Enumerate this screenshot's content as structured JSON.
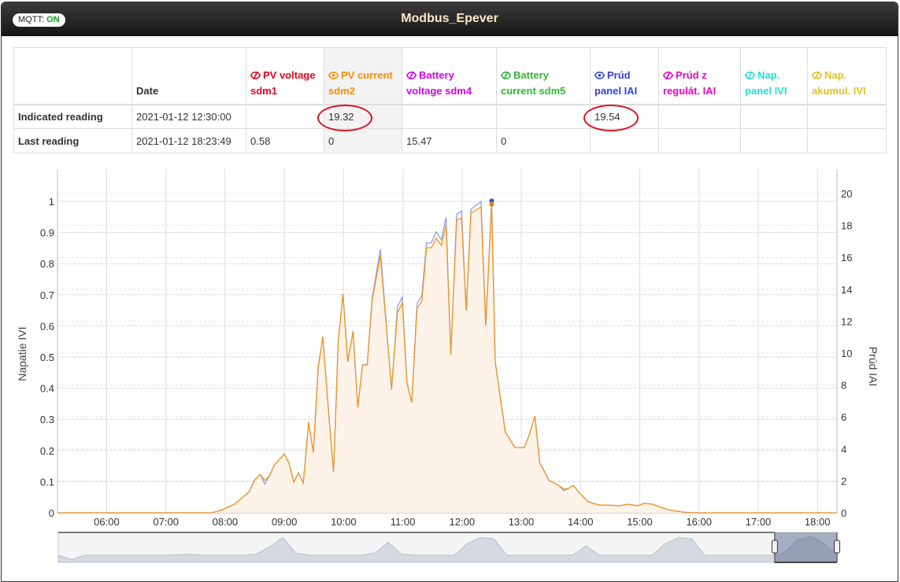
{
  "header": {
    "mqtt_label": "MQTT:",
    "mqtt_status": "ON",
    "title": "Modbus_Epever"
  },
  "table": {
    "date_header": "Date",
    "columns": [
      {
        "label": "PV voltage sdm1",
        "color": "#e8001c",
        "visible": false
      },
      {
        "label": "PV current sdm2",
        "color": "#ff8a00",
        "visible": true
      },
      {
        "label": "Battery voltage sdm4",
        "color": "#d600f0",
        "visible": false
      },
      {
        "label": "Battery current sdm5",
        "color": "#2fb82f",
        "visible": false
      },
      {
        "label": "Prúd panel IAI",
        "color": "#3340e0",
        "visible": true
      },
      {
        "label": "Prúd z regulát. IAI",
        "color": "#ee00c8",
        "visible": false
      },
      {
        "label": "Nap. panel IVI",
        "color": "#20e0d8",
        "visible": false
      },
      {
        "label": "Nap. akumul. IVI",
        "color": "#e6c020",
        "visible": false
      }
    ],
    "rows": [
      {
        "label": "Indicated reading",
        "date": "2021-01-12 12:30:00",
        "values": [
          "",
          "19.32",
          "",
          "",
          "19.54",
          "",
          "",
          ""
        ]
      },
      {
        "label": "Last reading",
        "date": "2021-01-12 18:23:49",
        "values": [
          "0.58",
          "0",
          "15.47",
          "0",
          "",
          "",
          "",
          ""
        ]
      }
    ]
  },
  "chart_data": {
    "type": "area",
    "left_axis": {
      "label": "Napatie IVI",
      "min": 0,
      "max": 1,
      "ticks": [
        "0",
        "0.1",
        "0.2",
        "0.3",
        "0.4",
        "0.5",
        "0.6",
        "0.7",
        "0.8",
        "0.9",
        "1"
      ]
    },
    "right_axis": {
      "label": "Prúd IAI",
      "min": 0,
      "max": 20,
      "ticks": [
        "0",
        "2",
        "4",
        "6",
        "8",
        "10",
        "12",
        "14",
        "16",
        "18",
        "20"
      ]
    },
    "x_axis": {
      "min": 5.17,
      "max": 18.33,
      "ticks": [
        "06:00",
        "07:00",
        "08:00",
        "09:00",
        "10:00",
        "11:00",
        "12:00",
        "13:00",
        "14:00",
        "15:00",
        "16:00",
        "17:00",
        "18:00"
      ]
    },
    "x_hours": [
      5.17,
      7.76,
      7.93,
      8.16,
      8.41,
      8.49,
      8.59,
      8.67,
      8.75,
      8.83,
      9.0,
      9.08,
      9.16,
      9.24,
      9.32,
      9.41,
      9.49,
      9.57,
      9.65,
      9.73,
      9.83,
      9.91,
      9.99,
      10.07,
      10.16,
      10.24,
      10.32,
      10.4,
      10.48,
      10.62,
      10.81,
      10.91,
      10.99,
      11.07,
      11.15,
      11.24,
      11.32,
      11.4,
      11.48,
      11.56,
      11.65,
      11.73,
      11.81,
      11.91,
      11.99,
      12.07,
      12.15,
      12.32,
      12.4,
      12.5,
      12.56,
      12.73,
      12.89,
      13.05,
      13.13,
      13.23,
      13.31,
      13.47,
      13.63,
      13.72,
      13.8,
      13.88,
      13.97,
      14.13,
      14.32,
      14.47,
      14.65,
      14.8,
      14.97,
      15.07,
      15.21,
      15.36,
      15.53,
      15.73,
      15.89,
      18.33
    ],
    "series": [
      {
        "name": "PV current sdm2",
        "axis": "right",
        "color": "#f7931e",
        "values": [
          0,
          0,
          0.15,
          0.54,
          1.33,
          2.02,
          2.41,
          2.02,
          2.32,
          2.99,
          3.69,
          3.1,
          1.92,
          2.51,
          1.87,
          5.67,
          3.79,
          9.06,
          11.03,
          7.14,
          2.56,
          10.79,
          13.7,
          9.46,
          11.38,
          6.6,
          9.26,
          9.26,
          13.25,
          16.1,
          7.83,
          12.53,
          13.15,
          8.18,
          6.9,
          12.82,
          13.25,
          16.6,
          16.6,
          17.19,
          16.75,
          18.03,
          9.9,
          18.33,
          18.47,
          12.66,
          18.77,
          19.16,
          11.72,
          19.32,
          9.46,
          5.07,
          4.09,
          4.09,
          4.83,
          6.06,
          3.15,
          2.02,
          1.72,
          1.48,
          1.53,
          1.72,
          1.28,
          0.69,
          0.49,
          0.49,
          0.44,
          0.54,
          0.44,
          0.59,
          0.54,
          0.34,
          0.15,
          0.05,
          0,
          0
        ]
      },
      {
        "name": "Prúd panel IAI",
        "axis": "right",
        "color": "#8aa0f0",
        "values": [
          0,
          0,
          0.15,
          0.54,
          1.33,
          2.02,
          2.41,
          1.8,
          2.32,
          2.99,
          3.69,
          3.1,
          1.92,
          2.51,
          1.87,
          5.67,
          3.79,
          9.06,
          11.03,
          7.14,
          2.56,
          10.79,
          13.7,
          9.46,
          11.38,
          6.6,
          9.26,
          9.3,
          13.4,
          16.5,
          7.7,
          12.9,
          13.5,
          8.18,
          6.9,
          13.1,
          13.6,
          16.9,
          16.9,
          17.6,
          17.1,
          18.5,
          9.9,
          18.7,
          18.9,
          12.66,
          19.0,
          19.5,
          11.72,
          19.54,
          9.46,
          5.07,
          4.09,
          4.09,
          4.83,
          6.06,
          3.15,
          2.02,
          1.72,
          1.38,
          1.53,
          1.72,
          1.28,
          0.69,
          0.49,
          0.49,
          0.44,
          0.54,
          0.44,
          0.59,
          0.54,
          0.34,
          0.15,
          0.05,
          0,
          0
        ]
      }
    ],
    "markers": [
      {
        "series": "Prúd panel IAI",
        "x": 12.5,
        "value": 19.54,
        "color": "#3050e0"
      },
      {
        "series": "PV current sdm2",
        "x": 12.5,
        "value": 19.32,
        "color": "#f07f00"
      }
    ],
    "navigator": {
      "values": [
        0.2,
        0.02,
        0.2,
        0.2,
        0.2,
        0.2,
        0.2,
        0.2,
        0.2,
        0.22,
        0.24,
        0.2,
        0.2,
        0.2,
        0.2,
        0.25,
        0.55,
        0.95,
        0.3,
        0.2,
        0.2,
        0.2,
        0.2,
        0.2,
        0.3,
        0.75,
        0.25,
        0.2,
        0.2,
        0.2,
        0.2,
        0.7,
        0.95,
        0.9,
        0.2,
        0.2,
        0.2,
        0.2,
        0.2,
        0.22,
        0.6,
        0.2,
        0.2,
        0.2,
        0.2,
        0.2,
        0.7,
        0.95,
        0.9,
        0.2,
        0.2,
        0.2,
        0.2,
        0.2,
        0.2,
        0.3,
        0.85,
        1.0,
        0.7,
        0.2
      ],
      "selected_from": 0.92,
      "selected_to": 1.0
    }
  }
}
